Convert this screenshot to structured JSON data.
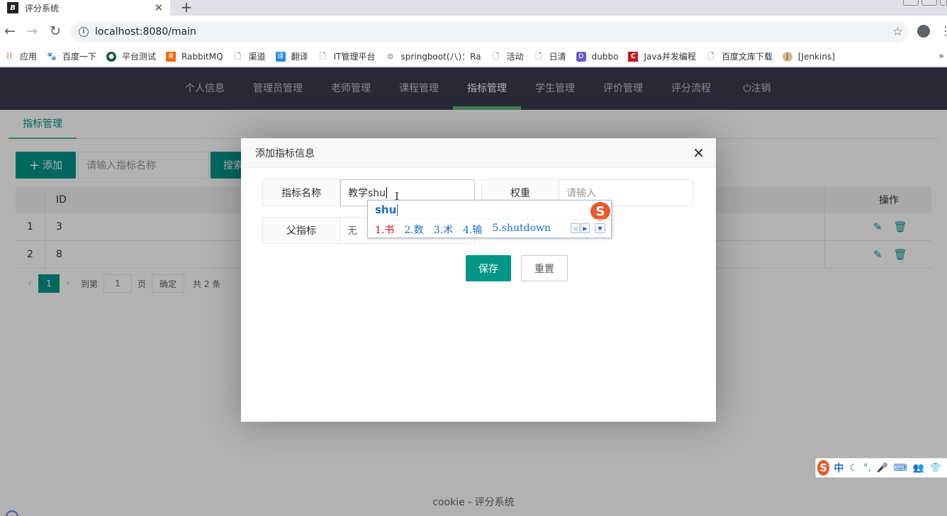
{
  "browser": {
    "tab_title": "评分系统",
    "tab_favicon": "B",
    "url": "localhost:8080/main",
    "bookmarks": [
      {
        "label": "应用",
        "icon": "apps-grid-icon"
      },
      {
        "label": "百度一下",
        "icon": "baidu-paw-icon"
      },
      {
        "label": "平台测试",
        "icon": "globe-icon"
      },
      {
        "label": "RabbitMQ",
        "icon": "rabbitmq-icon"
      },
      {
        "label": "渠道",
        "icon": "page-icon"
      },
      {
        "label": "翻译",
        "icon": "translate-icon"
      },
      {
        "label": "IT管理平台",
        "icon": "page-icon"
      },
      {
        "label": "springboot(八)：Ra",
        "icon": "springboot-icon"
      },
      {
        "label": "活动",
        "icon": "page-icon"
      },
      {
        "label": "日清",
        "icon": "page-icon"
      },
      {
        "label": "dubbo",
        "icon": "dubbo-icon"
      },
      {
        "label": "Java并发编程",
        "icon": "csdn-icon"
      },
      {
        "label": "百度文库下载",
        "icon": "page-icon"
      },
      {
        "label": "[Jenkins]",
        "icon": "jenkins-icon"
      }
    ],
    "bookmarks_overflow": "»"
  },
  "nav": {
    "items": [
      "个人信息",
      "管理员管理",
      "老师管理",
      "课程管理",
      "指标管理",
      "学生管理",
      "评价管理",
      "评分流程",
      "注销"
    ],
    "active": "指标管理"
  },
  "subtab": "指标管理",
  "toolbar": {
    "add_label": "添加",
    "search_placeholder": "请输入指标名称",
    "search_label": "搜索"
  },
  "table": {
    "headers": {
      "id": "ID",
      "ops": "操作"
    },
    "rows": [
      {
        "index": "1",
        "id": "3"
      },
      {
        "index": "2",
        "id": "8"
      }
    ]
  },
  "pager": {
    "current": "1",
    "goto_label": "到第",
    "goto_value": "1",
    "page_label": "页",
    "confirm_label": "确定",
    "total": "共 2 条"
  },
  "footer": "cookie - 评分系统",
  "modal": {
    "title": "添加指标信息",
    "fields": {
      "name_label": "指标名称",
      "name_value": "教学shu",
      "weight_label": "权重",
      "weight_placeholder": "请输入",
      "parent_label": "父指标",
      "parent_value": "无"
    },
    "save_label": "保存",
    "reset_label": "重置"
  },
  "ime": {
    "composition": "shu",
    "candidates": [
      "1.书",
      "2.数",
      "3.术",
      "4.输",
      "5.shutdown"
    ],
    "logo": "S",
    "status_bar": {
      "mode": "中"
    }
  },
  "colors": {
    "primary": "#009688",
    "nav_bg": "#393d49",
    "nav_active_bar": "#5fb878",
    "ime_blue": "#1a6fc4",
    "ime_red": "#d0021b",
    "sogou_orange": "#e85b2b"
  }
}
